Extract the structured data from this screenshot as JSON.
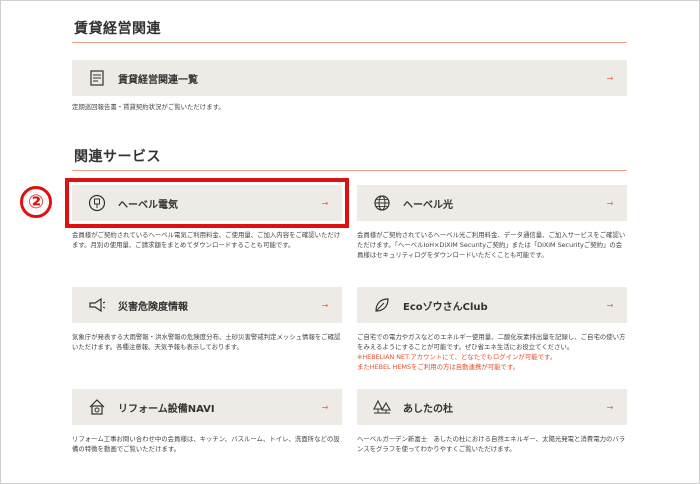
{
  "rental": {
    "title": "賃貸経営関連",
    "card_label": "賃貸経営関連一覧",
    "description": "定期巡回報告書・賃貸契約状況がご覧いただけます。"
  },
  "services": {
    "title": "関連サービス",
    "badge": "②",
    "cards": [
      {
        "label": "ヘーベル電気",
        "icon": "power-plug-icon",
        "description": "会員様がご契約されているヘーベル電気ご利用料金、ご使用量、ご加入内容をご確認いただけます。月別の使用量、ご請求額をまとめてダウンロードすることも可能です。"
      },
      {
        "label": "ヘーベル光",
        "icon": "globe-icon",
        "description": "会員様がご契約されているヘーベル光ご利用料金、データ通信量、ご加入サービスをご確認いただけます。「ヘーベルIoH×DiXiM Securityご契約」または「DiXiM Securityご契約」の会員様はセキュリティログをダウンロードいただくことも可能です。"
      },
      {
        "label": "災害危険度情報",
        "icon": "megaphone-icon",
        "description": "気象庁が発表する大雨警報・洪水警報の危険度分布、土砂災害警戒判定メッシュ情報をご確認いただけます。各種注意報、天気予報も表示しております。"
      },
      {
        "label": "EcoゾウさんClub",
        "icon": "leaf-icon",
        "description": "ご自宅での電力やガスなどのエネルギー使用量、二酸化炭素排出量を記録し、ご自宅の使い方をみえるようにすることが可能です。ぜひ省エネ生活にお役立てください。",
        "notes": [
          "※HEBELIAN NET.アカウントにて、どなたでもログインが可能です。",
          "またHEBEL HEMSをご利用の方は自動連携が可能です。"
        ]
      },
      {
        "label": "リフォーム設備NAVI",
        "icon": "house-gear-icon",
        "description": "リフォーム工事お問い合わせ中の会員様は、キッチン、バスルーム、トイレ、洗面所などの設備の特徴を動画でご覧いただけます。"
      },
      {
        "label": "あしたの杜",
        "icon": "forest-icon",
        "description": "ヘーベルガーデン新富士　あしたの杜における自然エネルギー、太陽光発電と消費電力のバランスをグラフを使ってわかりやすくご覧いただけます。"
      }
    ]
  },
  "colors": {
    "accent": "#e0674a",
    "card_bg": "#eeebe6",
    "highlight": "#e01010"
  }
}
